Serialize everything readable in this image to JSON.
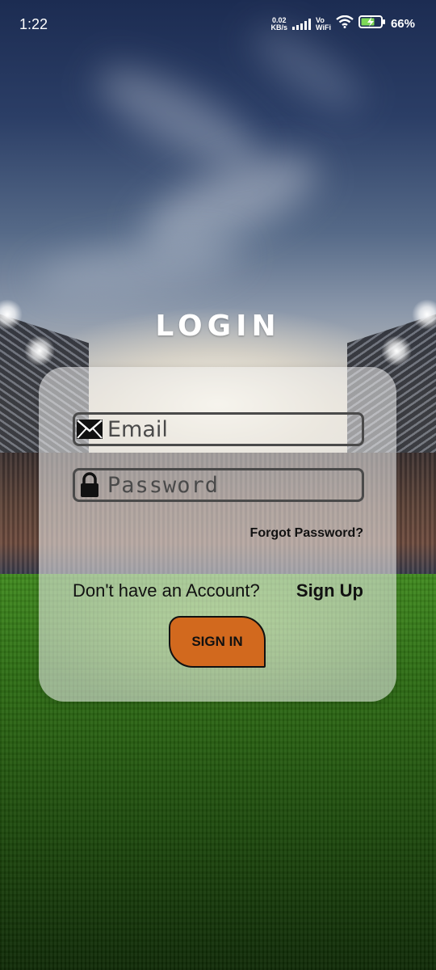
{
  "status_bar": {
    "time": "1:22",
    "net_speed_value": "0.02",
    "net_speed_unit": "KB/s",
    "vowifi_top": "Vo",
    "vowifi_bottom": "WiFi",
    "battery_percent": "66%",
    "icons": [
      "signal-icon",
      "wifi-icon",
      "battery-charging-icon"
    ]
  },
  "login": {
    "title": "LOGIN",
    "email_placeholder": "Email",
    "password_placeholder": "Password",
    "forgot_password": "Forgot Password?",
    "no_account_text": "Don't have an Account?",
    "sign_up_label": "Sign Up",
    "sign_in_label": "SIGN IN"
  },
  "colors": {
    "sign_in_button": "#d2691e",
    "card_background": "rgba(240,240,240,0.55)",
    "field_border": "#4a4a4a"
  }
}
